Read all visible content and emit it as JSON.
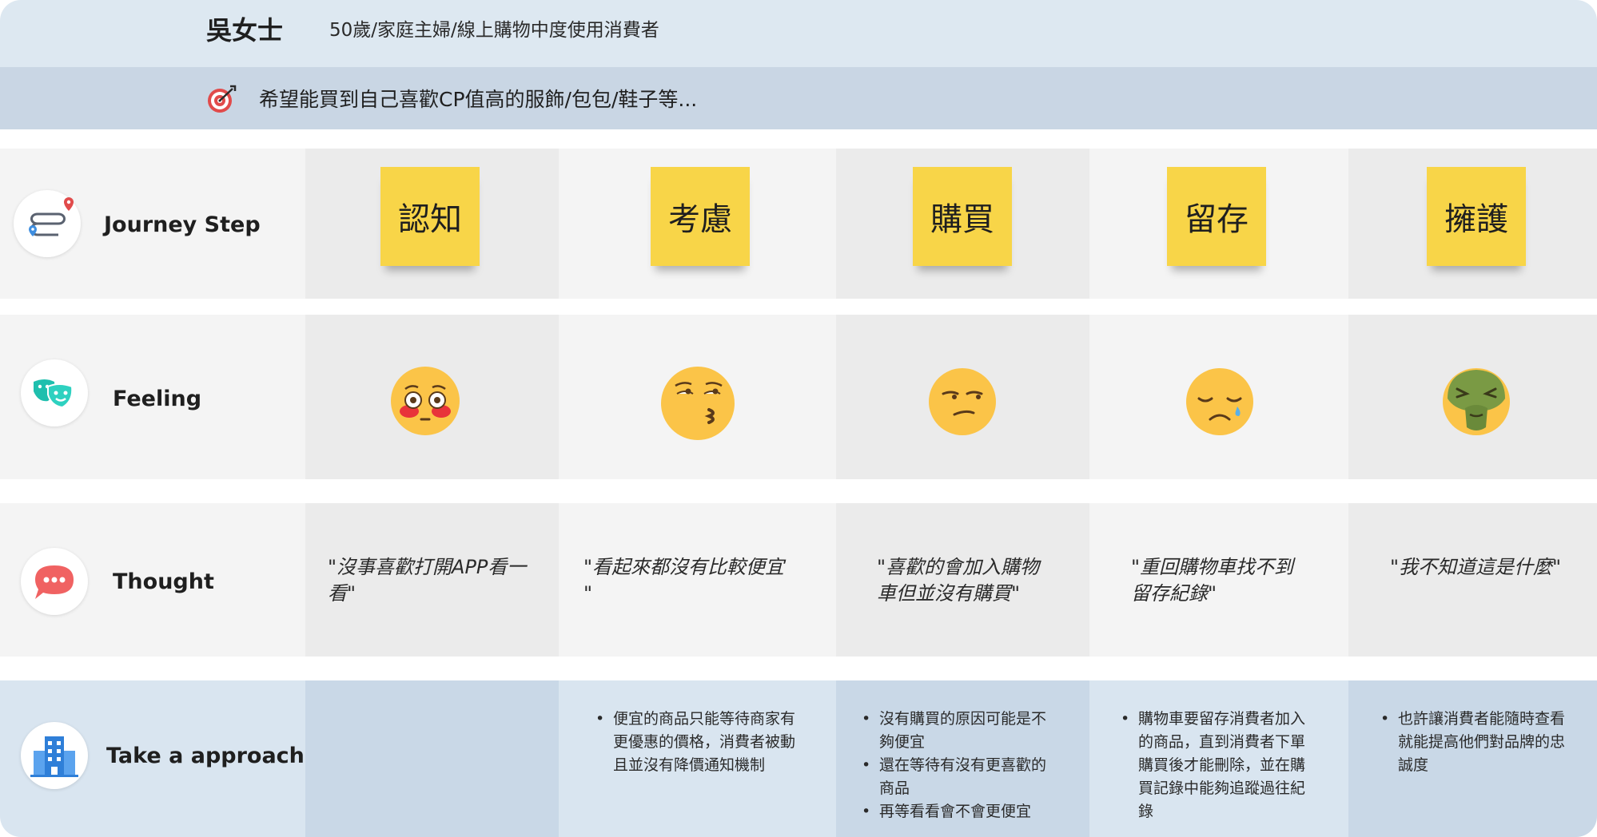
{
  "persona": {
    "name": "吳女士",
    "description": "50歲/家庭主婦/線上購物中度使用消費者",
    "goal_icon": "target-icon",
    "goal": "希望能買到自己喜歡CP值高的服飾/包包/鞋子等..."
  },
  "rows": {
    "journey": {
      "label": "Journey Step",
      "icon": "route-map-icon"
    },
    "feeling": {
      "label": "Feeling",
      "icon": "theater-masks-icon"
    },
    "thought": {
      "label": "Thought",
      "icon": "speech-bubble-icon"
    },
    "approach": {
      "label": "Take a approach",
      "icon": "building-icon"
    }
  },
  "stages": [
    {
      "step": "認知",
      "feeling": "flushed-face-emoji",
      "thought": "\"沒事喜歡打開APP看一看\"",
      "thought_lines": [
        "\"沒事喜歡打開APP看一",
        "看\""
      ],
      "approach": []
    },
    {
      "step": "考慮",
      "feeling": "kissing-rolling-eyes-emoji",
      "thought": "\"看起來都沒有比較便宜\"",
      "thought_lines": [
        "\"看起來都沒有比較便宜",
        "\""
      ],
      "approach": [
        "便宜的商品只能等待商家有更優惠的價格，消費者被動且並沒有降價通知機制"
      ],
      "approach_lines": [
        [
          "便宜的商品只能等待商家有",
          "更優惠的價格，消費者被動",
          "且並沒有降價通知機制"
        ]
      ]
    },
    {
      "step": "購買",
      "feeling": "unamused-face-emoji",
      "thought": "\"喜歡的會加入購物車但並沒有購買\"",
      "thought_lines": [
        "\"喜歡的會加入購物",
        "車但並沒有購買\""
      ],
      "approach": [
        "沒有購買的原因可能是不夠便宜",
        "還在等待有沒有更喜歡的商品",
        "再等看看會不會更便宜"
      ],
      "approach_lines": [
        [
          "沒有購買的原因可能是不",
          "夠便宜"
        ],
        [
          "還在等待有沒有更喜歡的",
          "商品"
        ],
        [
          "再等看看會不會更便宜"
        ]
      ]
    },
    {
      "step": "留存",
      "feeling": "sad-sweat-face-emoji",
      "thought": "\"重回購物車找不到留存紀錄\"",
      "thought_lines": [
        "\"重回購物車找不到",
        "留存紀錄\""
      ],
      "approach": [
        "購物車要留存消費者加入的商品，直到消費者下單購買後才能刪除，並在購買記錄中能夠追蹤過往紀錄"
      ],
      "approach_lines": [
        [
          "購物車要留存消費者加入",
          "的商品，直到消費者下單",
          "購買後才能刪除，並在購",
          "買記錄中能夠追蹤過往紀",
          "錄"
        ]
      ]
    },
    {
      "step": "擁護",
      "feeling": "nauseated-face-emoji",
      "thought": "\"我不知道這是什麼\"",
      "thought_lines": [
        "\"我不知道這是什麼\""
      ],
      "approach": [
        "也許讓消費者能隨時查看就能提高他們對品牌的忠誠度"
      ],
      "approach_lines": [
        [
          "也許讓消費者能隨時查看",
          "就能提高他們對品牌的忠",
          "誠度"
        ]
      ]
    }
  ],
  "colors": {
    "header_band": "#dde8f1",
    "goal_band": "#c9d6e4",
    "sticky_note": "#f8d548",
    "emoji_yellow": "#fbc448",
    "approach_band": "#d9e5f0"
  }
}
